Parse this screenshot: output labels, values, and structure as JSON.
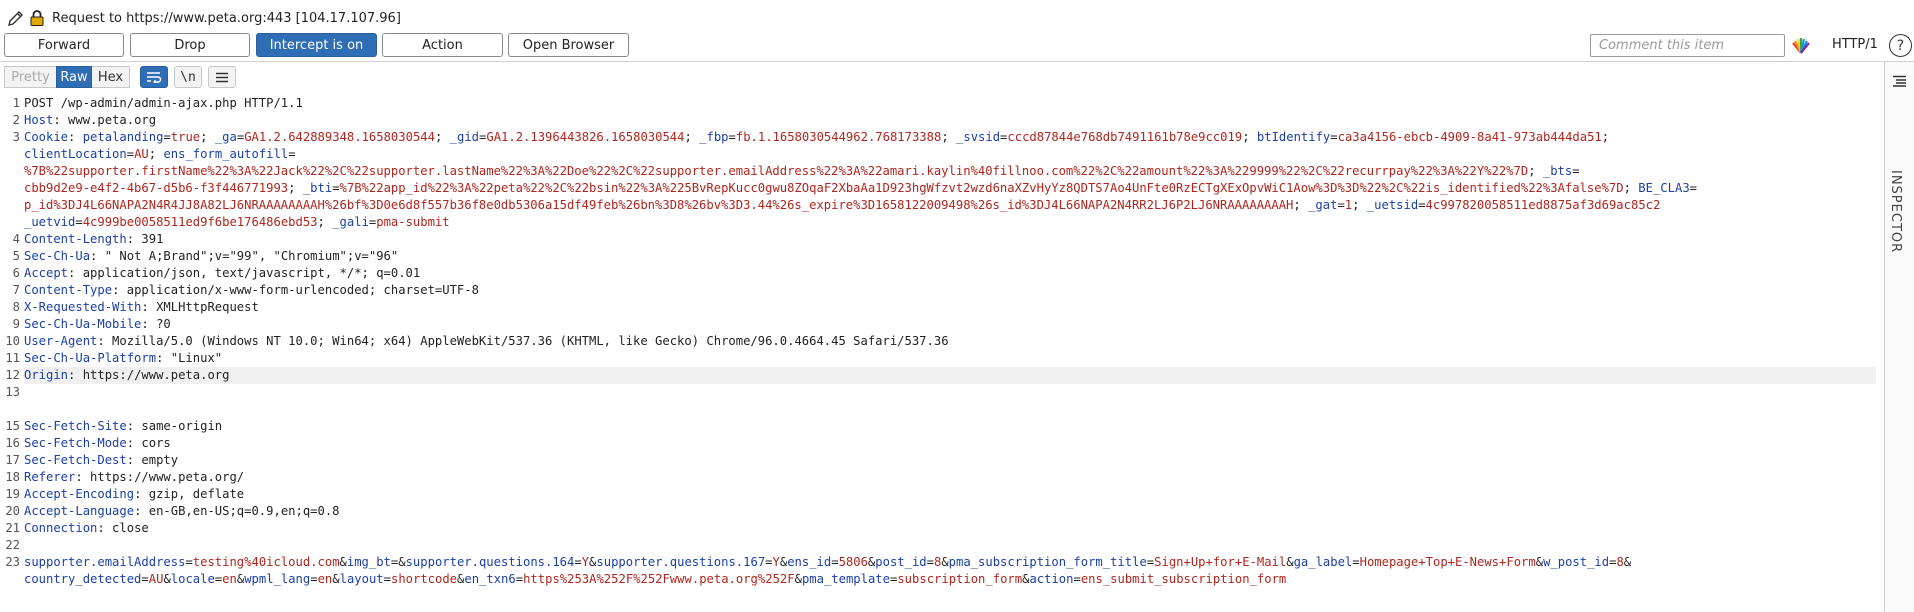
{
  "title_bar": {
    "text": "Request to https://www.peta.org:443  [104.17.107.96]",
    "icons": [
      "pencil-icon",
      "lock-icon"
    ]
  },
  "toolbar": {
    "forward": "Forward",
    "drop": "Drop",
    "intercept": "Intercept is on",
    "action": "Action",
    "open_browser": "Open Browser",
    "comment_placeholder": "Comment this item",
    "http_version": "HTTP/1",
    "help": "?"
  },
  "editor_toolbar": {
    "pretty": "Pretty",
    "raw": "Raw",
    "hex": "Hex",
    "newline": "\\n",
    "selected_view": "Raw"
  },
  "inspector": {
    "label": "INSPECTOR"
  },
  "colors": {
    "accent": "#2f6db5",
    "header_name": "#1b3fa8",
    "param_value": "#b0261e",
    "highlighted_line_bg": "#f0f0f0"
  },
  "highlighted_line": 12,
  "request": {
    "l1": "POST /wp-admin/admin-ajax.php HTTP/1.1",
    "l2": {
      "name": "Host",
      "value": " www.peta.org"
    },
    "l3": {
      "name": "Cookie",
      "r1": [
        [
          "petalanding",
          "true"
        ],
        [
          "_ga",
          "GA1.2.642889348.1658030544"
        ],
        [
          "_gid",
          "GA1.2.1396443826.1658030544"
        ],
        [
          "_fbp",
          "fb.1.1658030544962.768173388"
        ],
        [
          "_svsid",
          "cccd87844e768db7491161b78e9cc019"
        ],
        [
          "btIdentify",
          "ca3a4156-ebcb-4909-8a41-973ab444da51"
        ]
      ],
      "r2": [
        [
          "clientLocation",
          "AU"
        ],
        [
          "ens_form_autofill",
          ""
        ]
      ],
      "r3": [
        [
          "",
          "%7B%22supporter.firstName%22%3A%22Jack%22%2C%22supporter.lastName%22%3A%22Doe%22%2C%22supporter.emailAddress%22%3A%22amari.kaylin%40fillnoo.com%22%2C%22amount%22%3A%229999%22%2C%22recurrpay%22%3A%22Y%22%7D"
        ],
        [
          "_bts",
          ""
        ]
      ],
      "r4": [
        [
          "",
          "cbb9d2e9-e4f2-4b67-d5b6-f3f446771993"
        ],
        [
          "_bti",
          "%7B%22app_id%22%3A%22peta%22%2C%22bsin%22%3A%225BvRepKucc0gwu8ZOqaF2XbaAa1D923hgWfzvt2wzd6naXZvHyYz8QDTS7Ao4UnFte0RzECTgXExOpvWiC1Aow%3D%3D%22%2C%22is_identified%22%3Afalse%7D"
        ],
        [
          "BE_CLA3",
          ""
        ]
      ],
      "r5": [
        [
          "",
          "p_id%3DJ4L66NAPA2N4R4JJ8A82LJ6NRAAAAAAAAH%26bf%3D0e6d8f557b36f8e0db5306a15df49feb%26bn%3D8%26bv%3D3.44%26s_expire%3D1658122009498%26s_id%3DJ4L66NAPA2N4RR2LJ6P2LJ6NRAAAAAAAAH"
        ],
        [
          "_gat",
          "1"
        ],
        [
          "_uetsid",
          "4c997820058511ed8875af3d69ac85c2"
        ]
      ],
      "r6": [
        [
          "_uetvid",
          "4c999be0058511ed9f6be176486ebd53"
        ],
        [
          "_gali",
          "pma-submit"
        ]
      ]
    },
    "l4": {
      "name": "Content-Length",
      "value": " 391"
    },
    "l5": {
      "name": "Sec-Ch-Ua",
      "value": " \" Not A;Brand\";v=\"99\", \"Chromium\";v=\"96\""
    },
    "l6": {
      "name": "Accept",
      "value": " application/json, text/javascript, */*; q=0.01"
    },
    "l7": {
      "name": "Content-Type",
      "value": " application/x-www-form-urlencoded; charset=UTF-8"
    },
    "l8": {
      "name": "X-Requested-With",
      "value": " XMLHttpRequest"
    },
    "l9": {
      "name": "Sec-Ch-Ua-Mobile",
      "value": " ?0"
    },
    "l10": {
      "name": "User-Agent",
      "value": " Mozilla/5.0 (Windows NT 10.0; Win64; x64) AppleWebKit/537.36 (KHTML, like Gecko) Chrome/96.0.4664.45 Safari/537.36"
    },
    "l11": {
      "name": "Sec-Ch-Ua-Platform",
      "value": " \"Linux\""
    },
    "l12": {
      "name": "Origin",
      "value": " https://www.peta.org"
    },
    "l15": {
      "name": "Sec-Fetch-Site",
      "value": " same-origin"
    },
    "l16": {
      "name": "Sec-Fetch-Mode",
      "value": " cors"
    },
    "l17": {
      "name": "Sec-Fetch-Dest",
      "value": " empty"
    },
    "l18": {
      "name": "Referer",
      "value": " https://www.peta.org/"
    },
    "l19": {
      "name": "Accept-Encoding",
      "value": " gzip, deflate"
    },
    "l20": {
      "name": "Accept-Language",
      "value": " en-GB,en-US;q=0.9,en;q=0.8"
    },
    "l21": {
      "name": "Connection",
      "value": " close"
    },
    "body_r1": [
      [
        "supporter.emailAddress",
        "testing%40icloud.com"
      ],
      [
        "img_bt",
        ""
      ],
      [
        "supporter.questions.164",
        "Y"
      ],
      [
        "supporter.questions.167",
        "Y"
      ],
      [
        "ens_id",
        "5806"
      ],
      [
        "post_id",
        "8"
      ],
      [
        "pma_subscription_form_title",
        "Sign+Up+for+E-Mail"
      ],
      [
        "ga_label",
        "Homepage+Top+E-News+Form"
      ],
      [
        "w_post_id",
        "8"
      ]
    ],
    "body_r2": [
      [
        "country_detected",
        "AU"
      ],
      [
        "locale",
        "en"
      ],
      [
        "wpml_lang",
        "en"
      ],
      [
        "layout",
        "shortcode"
      ],
      [
        "en_txn6",
        "https%253A%252F%252Fwww.peta.org%252F"
      ],
      [
        "pma_template",
        "subscription_form"
      ],
      [
        "action",
        "ens_submit_subscription_form"
      ]
    ]
  }
}
